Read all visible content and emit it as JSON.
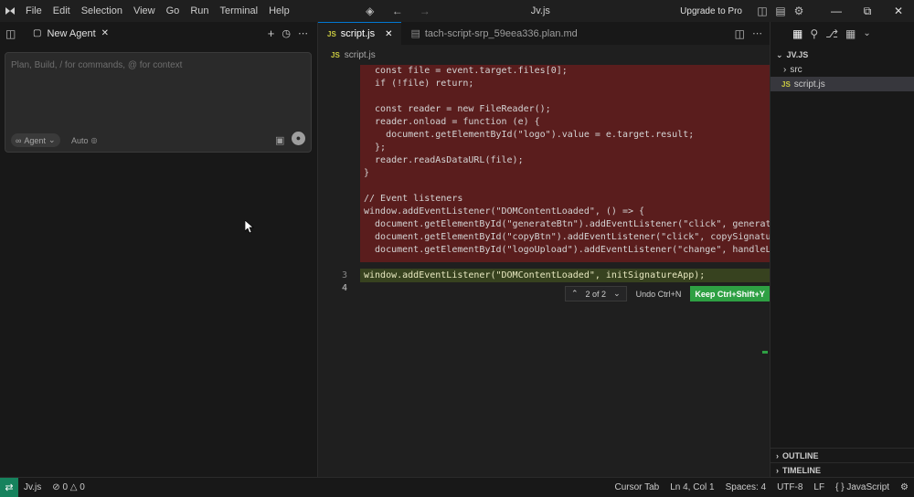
{
  "titlebar": {
    "menu": [
      "File",
      "Edit",
      "Selection",
      "View",
      "Go",
      "Run",
      "Terminal",
      "Help"
    ],
    "title": "Jv.js",
    "upgrade": "Upgrade to Pro"
  },
  "agent_panel": {
    "tab_label": "New Agent",
    "placeholder": "Plan, Build, / for commands, @ for context",
    "mode_label": "Agent",
    "model_label": "Auto"
  },
  "editor": {
    "tabs": [
      {
        "label": "script.js",
        "active": true
      },
      {
        "label": "tach-script-srp_59eea336.plan.md",
        "active": false
      }
    ],
    "breadcrumb": "script.js",
    "deleted_lines": [
      "  const file = event.target.files[0];",
      "  if (!file) return;",
      "",
      "  const reader = new FileReader();",
      "  reader.onload = function (e) {",
      "    document.getElementById(\"logo\").value = e.target.result;",
      "  };",
      "  reader.readAsDataURL(file);",
      "}",
      "",
      "// Event listeners",
      "window.addEventListener(\"DOMContentLoaded\", () => {",
      "  document.getElementById(\"generateBtn\").addEventListener(\"click\", generateSign",
      "  document.getElementById(\"copyBtn\").addEventListener(\"click\", copySignature);",
      "  document.getElementById(\"logoUpload\").addEventListener(\"change\", handleLogoUp"
    ],
    "added_line": "window.addEventListener(\"DOMContentLoaded\", initSignatureApp);",
    "line_numbers": [
      "3",
      "4"
    ],
    "diff_nav": "2 of 2",
    "undo_label": "Undo Ctrl+N",
    "keep_label": "Keep Ctrl+Shift+Y"
  },
  "explorer": {
    "root": "JV.JS",
    "items": [
      {
        "label": "src",
        "type": "folder"
      },
      {
        "label": "script.js",
        "type": "file"
      }
    ],
    "outline": "OUTLINE",
    "timeline": "TIMELINE"
  },
  "statusbar": {
    "branch": "Jv.js",
    "problems": "0",
    "warnings": "0",
    "cursor_tab": "Cursor Tab",
    "position": "Ln 4, Col 1",
    "spaces": "Spaces: 4",
    "encoding": "UTF-8",
    "eol": "LF",
    "language": "JavaScript"
  },
  "colors": {
    "deleted_bg": "#5a1d1d",
    "added_bg": "#37421f",
    "keep_btn": "#2ea043",
    "remote": "#16825d"
  }
}
